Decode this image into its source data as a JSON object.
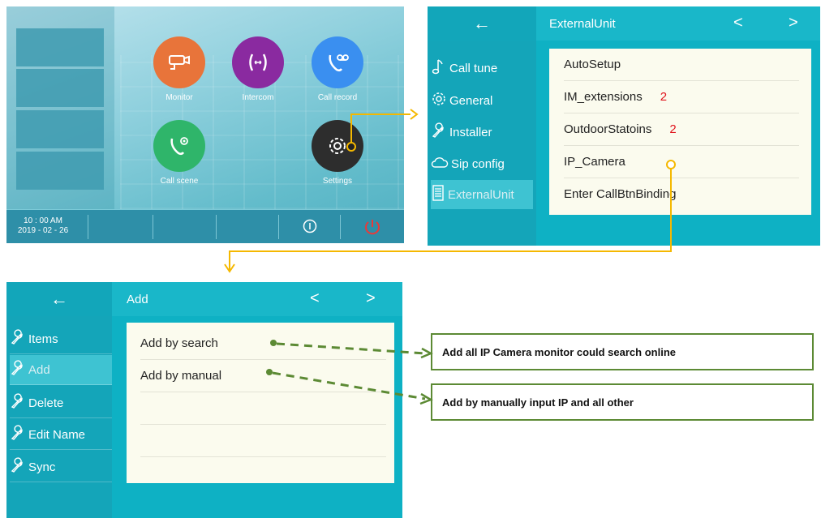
{
  "home": {
    "apps": [
      {
        "label": "Monitor",
        "color": "#e8743a",
        "icon": "camera-icon"
      },
      {
        "label": "Intercom",
        "color": "#8a2aa0",
        "icon": "intercom-icon"
      },
      {
        "label": "Call record",
        "color": "#3a8ff0",
        "icon": "voicemail-icon"
      },
      {
        "label": "Call scene",
        "color": "#2fb56a",
        "icon": "phone-settings-icon"
      },
      {
        "label": "Settings",
        "color": "#2d2d2d",
        "icon": "gear-icon"
      }
    ],
    "time": "10 : 00  AM",
    "date": "2019 - 02 - 26"
  },
  "ext": {
    "back": "←",
    "title": "ExternalUnit",
    "prev": "<",
    "next": ">",
    "sidebar": [
      {
        "label": "Call tune",
        "icon": "music-note-icon"
      },
      {
        "label": "General",
        "icon": "gear-icon"
      },
      {
        "label": "Installer",
        "icon": "wrench-icon"
      },
      {
        "label": "Sip config",
        "icon": "cloud-icon"
      },
      {
        "label": "ExternalUnit",
        "icon": "document-icon"
      }
    ],
    "rows": [
      {
        "label": "AutoSetup",
        "count": ""
      },
      {
        "label": "IM_extensions",
        "count": "2"
      },
      {
        "label": "OutdoorStatoins",
        "count": "2"
      },
      {
        "label": "IP_Camera",
        "count": ""
      },
      {
        "label": "Enter CallBtnBinding",
        "count": ""
      }
    ]
  },
  "add": {
    "back": "←",
    "title": "Add",
    "prev": "<",
    "next": ">",
    "sidebar": [
      {
        "label": "Items"
      },
      {
        "label": "Add"
      },
      {
        "label": "Delete"
      },
      {
        "label": "Edit Name"
      },
      {
        "label": "Sync"
      }
    ],
    "rows": [
      {
        "label": "Add by search"
      },
      {
        "label": "Add by manual"
      }
    ]
  },
  "callouts": [
    "Add all IP Camera monitor could search online",
    "Add by manually input IP and all other"
  ],
  "colors": {
    "accent": "#14a5b9",
    "connector": "#f5b800",
    "callout_border": "#5c8a34",
    "count": "#e0141c"
  }
}
